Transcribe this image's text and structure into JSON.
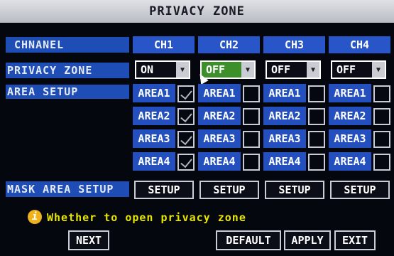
{
  "title": "PRIVACY ZONE",
  "labels": {
    "channel": "CHNANEL",
    "privacy_zone": "PRIVACY ZONE",
    "area_setup": "AREA SETUP",
    "mask_area_setup": "MASK AREA SETUP"
  },
  "channels": [
    "CH1",
    "CH2",
    "CH3",
    "CH4"
  ],
  "privacy_values": [
    "ON",
    "OFF",
    "OFF",
    "OFF"
  ],
  "areas": [
    "AREA1",
    "AREA2",
    "AREA3",
    "AREA4"
  ],
  "area_checked": [
    [
      true,
      true,
      true,
      true
    ],
    [
      false,
      false,
      false,
      false
    ],
    [
      false,
      false,
      false,
      false
    ],
    [
      false,
      false,
      false,
      false
    ]
  ],
  "setup_label": "SETUP",
  "info": {
    "icon": "info-icon",
    "text": "Whether to open privacy zone"
  },
  "buttons": {
    "next": "NEXT",
    "default": "DEFAULT",
    "apply": "APPLY",
    "exit": "EXIT"
  },
  "colors": {
    "accent_blue": "#2350be",
    "selected_green": "#3d8f2c",
    "info_yellow": "#e8e600"
  }
}
